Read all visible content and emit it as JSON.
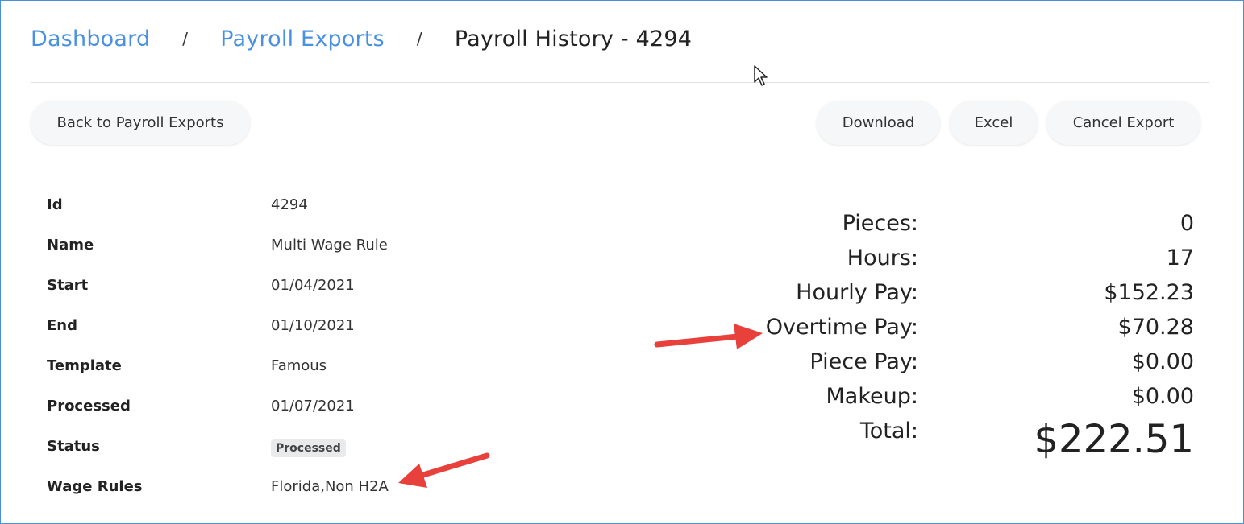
{
  "breadcrumb": {
    "items": [
      "Dashboard",
      "Payroll Exports"
    ],
    "separator": "/",
    "current": "Payroll History - 4294"
  },
  "toolbar": {
    "back_label": "Back to Payroll Exports",
    "download_label": "Download",
    "excel_label": "Excel",
    "cancel_label": "Cancel Export"
  },
  "details": [
    {
      "label": "Id",
      "value": "4294"
    },
    {
      "label": "Name",
      "value": "Multi Wage Rule"
    },
    {
      "label": "Start",
      "value": "01/04/2021"
    },
    {
      "label": "End",
      "value": "01/10/2021"
    },
    {
      "label": "Template",
      "value": "Famous"
    },
    {
      "label": "Processed",
      "value": "01/07/2021"
    },
    {
      "label": "Status",
      "value": "Processed"
    },
    {
      "label": "Wage Rules",
      "value": "Florida,Non H2A"
    }
  ],
  "summary": [
    {
      "label": "Pieces:",
      "value": "0"
    },
    {
      "label": "Hours:",
      "value": "17"
    },
    {
      "label": "Hourly Pay:",
      "value": "$152.23"
    },
    {
      "label": "Overtime Pay:",
      "value": "$70.28"
    },
    {
      "label": "Piece Pay:",
      "value": "$0.00"
    },
    {
      "label": "Makeup:",
      "value": "$0.00"
    },
    {
      "label": "Total:",
      "value": "$222.51"
    }
  ],
  "colors": {
    "link": "#4a90e2",
    "annotation_arrow": "#e8413c",
    "frame_border": "#4a90d9"
  },
  "annotations": [
    "red-arrow-overtime-pay",
    "red-arrow-wage-rules"
  ]
}
